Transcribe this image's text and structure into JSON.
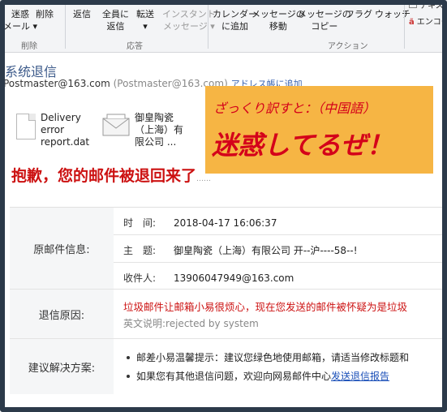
{
  "ribbon": {
    "delete_group": {
      "label": "削除",
      "buttons": [
        {
          "label": "迷惑",
          "label2": "メール ▾"
        },
        {
          "label": "削除",
          "label2": ""
        }
      ]
    },
    "respond_group": {
      "label": "応答",
      "buttons": [
        {
          "label": "返信",
          "label2": ""
        },
        {
          "label": "全員に",
          "label2": "返信"
        },
        {
          "label": "転送",
          "label2": "▾"
        },
        {
          "label": "インスタント",
          "label2": "メッセージ ▾"
        }
      ]
    },
    "action_group": {
      "label": "アクション",
      "buttons": [
        {
          "label": "カレンダー",
          "label2": "に追加"
        },
        {
          "label": "メッセージの",
          "label2": "移動"
        },
        {
          "label": "メッセージの",
          "label2": "コピー"
        },
        {
          "label": "フラグ",
          "label2": ""
        },
        {
          "label": "ウォッチ",
          "label2": ""
        }
      ]
    },
    "right_items": [
      "テキス",
      "エンコー"
    ]
  },
  "message": {
    "subject": "系统退信",
    "sender_name": "Postmaster@163.com",
    "sender_addr": "(Postmaster@163.com)",
    "add_contact": "アドレス帳に追加",
    "attachments": [
      {
        "name_lines": [
          "Delivery",
          "error",
          "report.dat"
        ]
      },
      {
        "name_lines": [
          "御皇陶瓷",
          "（上海）有",
          "限公司 ..."
        ]
      }
    ]
  },
  "note": {
    "small": "ざっくり訳すと：（中国語）",
    "big": "迷惑してるぜ！"
  },
  "bounce": {
    "title": "抱歉，您的邮件被退回来了",
    "title_suffix": "……",
    "original_label": "原邮件信息:",
    "time_key": "时　间:",
    "time_value": "2018-04-17 16:06:37",
    "subject_key": "主　题:",
    "subject_value": "御皇陶瓷（上海）有限公司 开--沪----58--!",
    "recipient_key": "收件人:",
    "recipient_value": "13906047949@163.com",
    "reason_label": "退信原因:",
    "reason_text": "垃圾邮件让邮箱小易很烦心，现在您发送的邮件被怀疑为是垃圾",
    "reason_en": "英文说明:rejected by system",
    "suggest_label": "建议解决方案:",
    "suggest_1": "邮差小易温馨提示：建议您绿色地使用邮箱，请适当修改标题和",
    "suggest_2_prefix": "如果您有其他退信问题，欢迎向网易邮件中心",
    "suggest_2_link": "发送退信报告"
  },
  "colors": {
    "accent_red": "#cc1111",
    "note_bg": "#f6b544",
    "subject_blue": "#3c5a8a"
  }
}
